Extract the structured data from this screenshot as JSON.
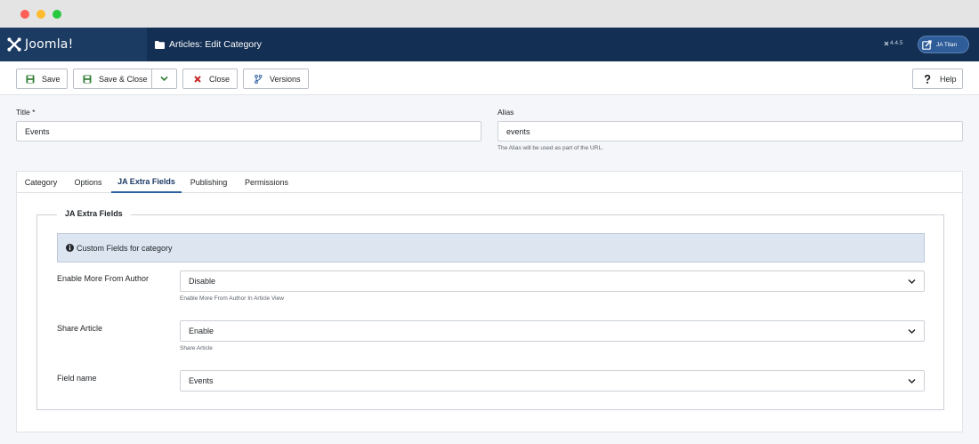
{
  "header": {
    "logo_text": "Joomla!",
    "page_title": "Articles: Edit Category",
    "version": "4.4.5",
    "user": "JA Titan"
  },
  "toolbar": {
    "save": "Save",
    "save_close": "Save & Close",
    "close": "Close",
    "versions": "Versions",
    "help": "Help"
  },
  "form": {
    "title_label": "Title *",
    "title_value": "Events",
    "alias_label": "Alias",
    "alias_value": "events",
    "alias_hint": "The Alias will be used as part of the URL."
  },
  "tabs": [
    {
      "label": "Category"
    },
    {
      "label": "Options"
    },
    {
      "label": "JA Extra Fields",
      "active": true
    },
    {
      "label": "Publishing"
    },
    {
      "label": "Permissions"
    }
  ],
  "extra_fields": {
    "legend": "JA Extra Fields",
    "alert": "Custom Fields for category",
    "fields": [
      {
        "label": "Enable More From Author",
        "value": "Disable",
        "hint": "Enable More From Author In Article View"
      },
      {
        "label": "Share Article",
        "value": "Enable",
        "hint": "Share Article"
      },
      {
        "label": "Field name",
        "value": "Events",
        "hint": ""
      }
    ]
  },
  "colors": {
    "header_bg": "#132f53",
    "logo_bg": "#1c3b63",
    "accent": "#2e5f9e",
    "close_red": "#c52827",
    "save_green": "#2f7d32"
  }
}
